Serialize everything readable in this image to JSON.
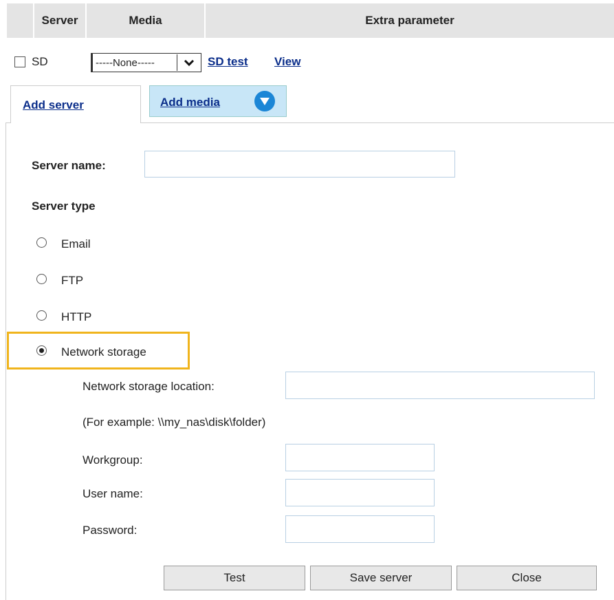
{
  "header": {
    "col_server": "Server",
    "col_media": "Media",
    "col_extra": "Extra parameter"
  },
  "sd_row": {
    "label": "SD",
    "checked": false,
    "media_select": "-----None-----",
    "sd_test": "SD test",
    "view": "View"
  },
  "tabs": {
    "add_server": "Add server",
    "add_media": "Add media"
  },
  "form": {
    "server_name_label": "Server name:",
    "server_name_value": "",
    "server_type_label": "Server type",
    "types": [
      {
        "label": "Email",
        "selected": false
      },
      {
        "label": "FTP",
        "selected": false
      },
      {
        "label": "HTTP",
        "selected": false
      },
      {
        "label": "Network storage",
        "selected": true
      }
    ],
    "network": {
      "location_label": "Network storage location:",
      "location_value": "",
      "example": "(For example: \\\\my_nas\\disk\\folder)",
      "workgroup_label": "Workgroup:",
      "workgroup_value": "",
      "username_label": "User name:",
      "username_value": "",
      "password_label": "Password:",
      "password_value": ""
    }
  },
  "buttons": {
    "test": "Test",
    "save": "Save server",
    "close": "Close"
  },
  "colors": {
    "highlight": "#f0b41c",
    "link": "#0a2d8a",
    "tab_active_bg": "#c8e6f7",
    "accent_icon": "#1b86d6"
  },
  "icons": {
    "select_arrow": "chevron-down-icon",
    "add_media_toggle": "triangle-down-icon"
  }
}
